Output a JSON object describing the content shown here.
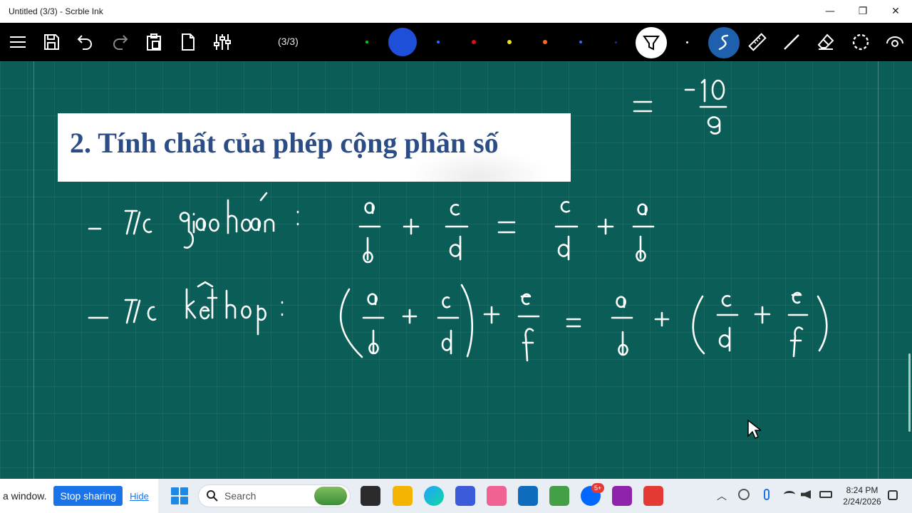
{
  "window": {
    "title": "Untitled (3/3) - Scrble Ink",
    "minimize_glyph": "—",
    "restore_glyph": "❐",
    "close_glyph": "✕"
  },
  "toolbar": {
    "page_indicator": "(3/3)",
    "icons": [
      "menu-icon",
      "save-icon",
      "undo-icon",
      "redo-icon",
      "clipboard-icon",
      "page-icon",
      "settings-sliders-icon"
    ],
    "pen_colors": [
      "#00d000",
      "#1e4fd8",
      "#1e4fd8",
      "#e01010",
      "#f0e020",
      "#ff6a20",
      "#2b6cff",
      "#1a2ea0"
    ],
    "active_color": "#1e4fd8",
    "right_icons": [
      "highlighter-icon",
      "pen-icon",
      "ruler-icon",
      "line-icon",
      "eraser-icon",
      "lasso-icon",
      "view-icon"
    ]
  },
  "canvas": {
    "heading": "2. Tính chất của phép cộng phân số",
    "background": "#0b5e57"
  },
  "taskbar": {
    "share_message": "a window.",
    "stop_sharing_label": "Stop sharing",
    "hide_label": "Hide",
    "search_placeholder": "Search",
    "zalo_badge": "5+",
    "time": "8:24 PM",
    "date": "2/24/2026"
  }
}
